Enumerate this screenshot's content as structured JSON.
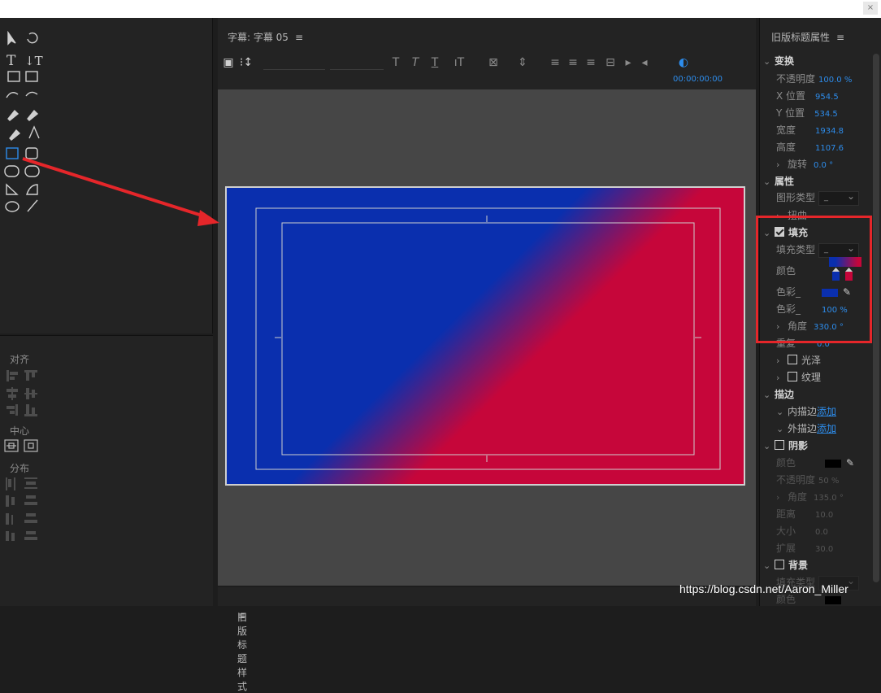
{
  "window": {
    "close_label": "×"
  },
  "tools_panel": {
    "tools": [
      "selection-tool",
      "rotation-tool",
      "type-tool",
      "vertical-type-tool",
      "area-type-tool",
      "vertical-area-type-tool",
      "path-type-tool",
      "vertical-path-type-tool",
      "pen-tool",
      "delete-anchor-tool",
      "add-anchor-tool",
      "convert-anchor-tool",
      "rectangle-tool",
      "rounded-rect-tool",
      "clipped-corner-rect-tool",
      "rounded-corner-rect-tool",
      "wedge-tool",
      "arc-tool",
      "ellipse-tool",
      "line-tool"
    ]
  },
  "align_panel": {
    "align_label": "对齐",
    "center_label": "中心",
    "distribute_label": "分布"
  },
  "title_panel": {
    "title": "字幕: 字幕 05",
    "menu_glyph": "≡",
    "timecode": "00:00:00:00"
  },
  "styles_panel": {
    "title": "旧版标题样式",
    "menu_glyph": "≡"
  },
  "properties": {
    "title": "旧版标题属性",
    "menu_glyph": "≡",
    "transform": {
      "label": "变换",
      "opacity_label": "不透明度",
      "opacity_value": "100.0 %",
      "x_label": "X 位置",
      "x_value": "954.5",
      "y_label": "Y 位置",
      "y_value": "534.5",
      "width_label": "宽度",
      "width_value": "1934.8",
      "height_label": "高度",
      "height_value": "1107.6",
      "rotation_label": "旋转",
      "rotation_value": "0.0 °"
    },
    "attributes": {
      "label": "属性",
      "graphic_type_label": "图形类型",
      "graphic_type_value": "_",
      "distort_label": "扭曲"
    },
    "fill": {
      "label": "填充",
      "fill_type_label": "填充类型",
      "fill_type_value": "_",
      "color_label": "颜色",
      "color_stop_label": "色彩_",
      "color_stop_opacity_label": "色彩_",
      "color_stop_opacity_value": "100 %",
      "angle_label": "角度",
      "angle_value": "330.0 °",
      "repeat_label": "重复",
      "repeat_value": "0.0",
      "sheen_label": "光泽",
      "texture_label": "纹理"
    },
    "strokes": {
      "label": "描边",
      "inner_label": "内描边",
      "inner_action": "添加",
      "outer_label": "外描边",
      "outer_action": "添加"
    },
    "shadow": {
      "label": "阴影",
      "color_label": "颜色",
      "opacity_label": "不透明度",
      "opacity_value": "50 %",
      "angle_label": "角度",
      "angle_value": "135.0 °",
      "distance_label": "距离",
      "distance_value": "10.0",
      "size_label": "大小",
      "size_value": "0.0",
      "spread_label": "扩展",
      "spread_value": "30.0"
    },
    "background": {
      "label": "背景",
      "fill_type_label": "填充类型",
      "color_label": "颜色"
    }
  },
  "colors": {
    "gradient_start": "#0a2fae",
    "gradient_end": "#c6063a",
    "accent": "#2d8ceb",
    "highlight": "#e5262a"
  },
  "watermark": "https://blog.csdn.net/Aaron_Miller"
}
